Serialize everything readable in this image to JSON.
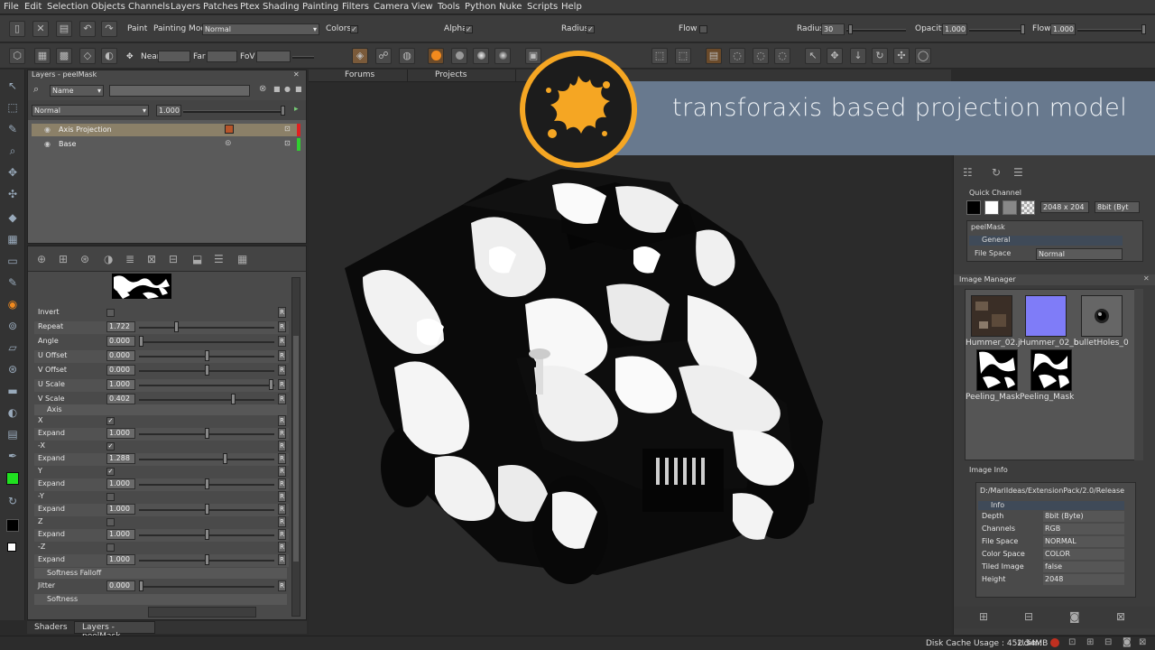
{
  "menu": [
    "File",
    "Edit",
    "Selection",
    "Objects",
    "Channels",
    "Layers",
    "Patches",
    "Ptex",
    "Shading",
    "Painting",
    "Filters",
    "Camera",
    "View",
    "Tools",
    "Python",
    "Nuke",
    "Scripts",
    "Help"
  ],
  "toolbar": {
    "paint_label": "Paint",
    "painting_mode_label": "Painting Mode",
    "painting_mode_value": "Normal",
    "colors_label": "Colors",
    "alpha_label": "Alpha",
    "radius_label": "Radius",
    "flow_label": "Flow",
    "radius2_label": "Radius",
    "radius_value": "30",
    "opacity_label": "Opacity",
    "opacity_value": "1.000",
    "flow2_label": "Flow",
    "flow_value": "1.000",
    "near_label": "Near",
    "far_label": "Far",
    "fov_label": "FoV"
  },
  "layers_panel": {
    "title": "Layers - peelMask",
    "filter_mode": "Name",
    "blend_mode": "Normal",
    "opacity": "1.000",
    "layers": [
      {
        "name": "Axis Projection",
        "selected": true,
        "color": "#e02020"
      },
      {
        "name": "Base",
        "selected": false,
        "color": "#30d030"
      }
    ]
  },
  "properties": {
    "rows": [
      {
        "label": "Invert",
        "type": "check",
        "checked": false
      },
      {
        "label": "Repeat",
        "type": "slider",
        "value": "1.722",
        "pos": 0.27
      },
      {
        "label": "Angle",
        "type": "slider",
        "value": "0.000",
        "pos": 0.0
      },
      {
        "label": "U Offset",
        "type": "slider",
        "value": "0.000",
        "pos": 0.5
      },
      {
        "label": "V Offset",
        "type": "slider",
        "value": "0.000",
        "pos": 0.5
      },
      {
        "label": "U Scale",
        "type": "slider",
        "value": "1.000",
        "pos": 0.99
      },
      {
        "label": "V Scale",
        "type": "slider",
        "value": "0.402",
        "pos": 0.7
      }
    ],
    "axis_section": "Axis",
    "axis_rows": [
      {
        "label": "X",
        "type": "check",
        "checked": true
      },
      {
        "label": "Expand",
        "type": "slider",
        "value": "1.000",
        "pos": 0.5
      },
      {
        "label": "-X",
        "type": "check",
        "checked": true
      },
      {
        "label": "Expand",
        "type": "slider",
        "value": "1.288",
        "pos": 0.64
      },
      {
        "label": "Y",
        "type": "check",
        "checked": true
      },
      {
        "label": "Expand",
        "type": "slider",
        "value": "1.000",
        "pos": 0.5
      },
      {
        "label": "-Y",
        "type": "check",
        "checked": false
      },
      {
        "label": "Expand",
        "type": "slider",
        "value": "1.000",
        "pos": 0.5
      },
      {
        "label": "Z",
        "type": "check",
        "checked": false
      },
      {
        "label": "Expand",
        "type": "slider",
        "value": "1.000",
        "pos": 0.5
      },
      {
        "label": "-Z",
        "type": "check",
        "checked": false
      },
      {
        "label": "Expand",
        "type": "slider",
        "value": "1.000",
        "pos": 0.5
      }
    ],
    "softness_falloff_section": "Softness Falloff",
    "jitter_label": "Jitter",
    "jitter_value": "0.000",
    "softness_section": "Softness",
    "reset_label": "R"
  },
  "bottom_tabs": [
    "Shaders",
    "Layers - peelMask"
  ],
  "viewport_tabs": [
    "Forums",
    "Projects"
  ],
  "banner": {
    "text": "transforaxis based projection model"
  },
  "right": {
    "quick_channel_label": "Quick Channel",
    "size_value": "2048 x 204",
    "depth_value": "8bit (Byt",
    "channel_name": "peelMask",
    "general_section": "General",
    "file_space_label": "File Space",
    "file_space_value": "Normal",
    "image_manager_title": "Image Manager",
    "images": [
      {
        "name": "Hummer_02.j"
      },
      {
        "name": "Hummer_02_b"
      },
      {
        "name": "bulletHoles_0"
      },
      {
        "name": "Peeling_Mask"
      },
      {
        "name": "Peeling_Mask"
      }
    ],
    "image_info_title": "Image Info",
    "image_path": "D:/MariIdeas/ExtensionPack/2.0/ReleaseS",
    "info_section": "Info",
    "info_rows": [
      {
        "k": "Depth",
        "v": "8bit (Byte)"
      },
      {
        "k": "Channels",
        "v": "RGB"
      },
      {
        "k": "File Space",
        "v": "NORMAL"
      },
      {
        "k": "Color Space",
        "v": "COLOR"
      },
      {
        "k": "Tiled Image",
        "v": "false"
      },
      {
        "k": "Height",
        "v": "2048"
      }
    ]
  },
  "status": {
    "disk_cache": "Disk Cache Usage : 452.34MB",
    "udim": "Udim:"
  },
  "colors": {
    "accent_orange": "#f5a623",
    "banner_blue": "#6b7d93",
    "fg_swatch": "#20e020"
  }
}
